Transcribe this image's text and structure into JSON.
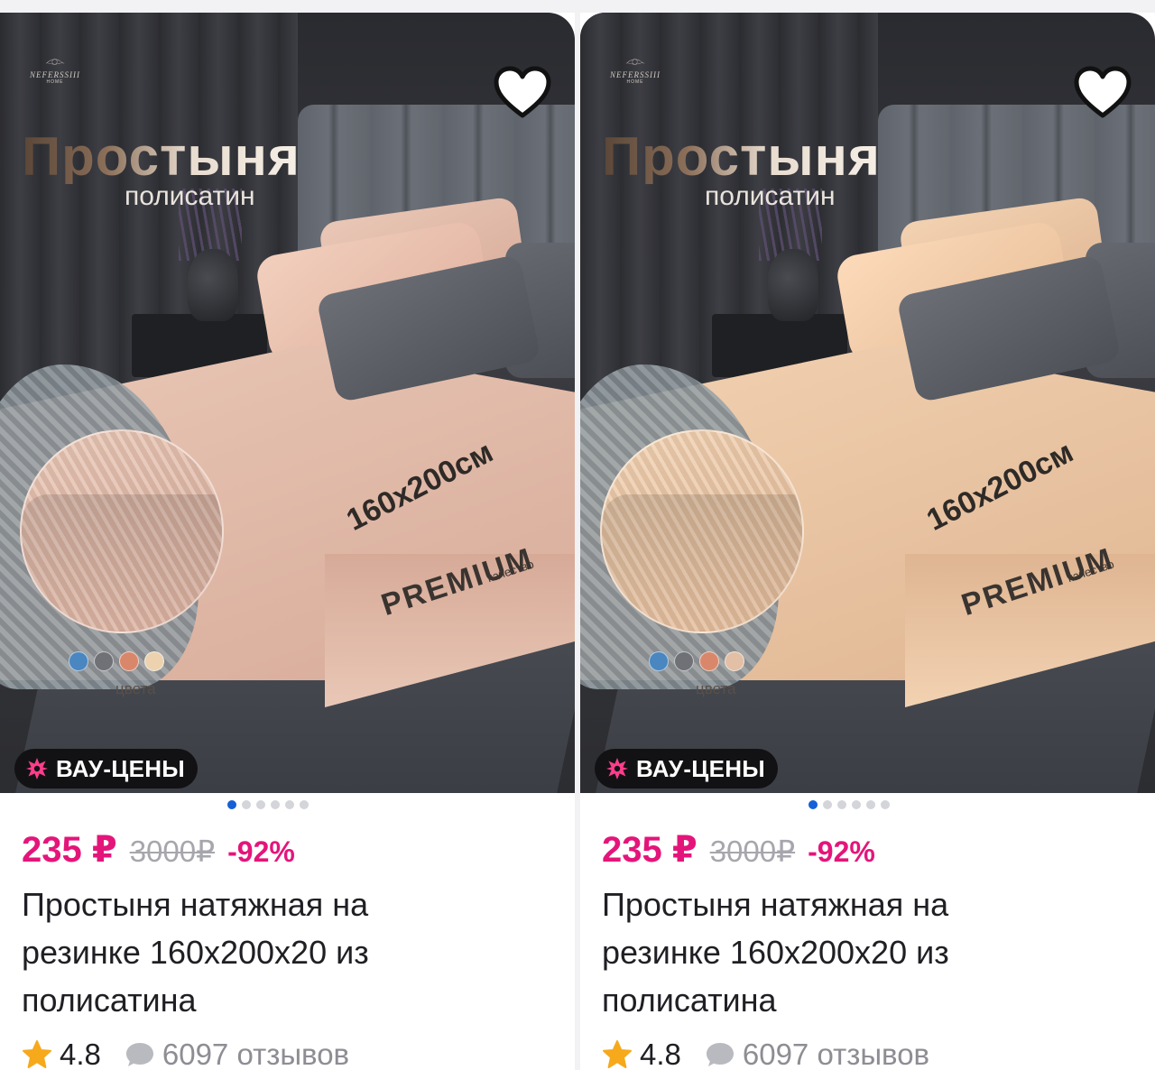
{
  "cards": [
    {
      "image": {
        "brand": "NEFERSSIII",
        "brand_sub": "HOME",
        "title": "Простыня",
        "subtitle": "полисатин",
        "size": "160x200см",
        "premium": "PREMIUM",
        "quality": "качество",
        "colors_label": "цвета",
        "swatch_colors": [
          "#4a86c0",
          "#6f7177",
          "#d9876b",
          "#ecd2ae"
        ],
        "sheet_color": "#e9c7b6",
        "sheet_color_dark": "#d7aa98"
      },
      "badge": {
        "label": "ВАУ-ЦЕНЫ",
        "icon": "burst-icon",
        "icon_color": "#ff3d8b"
      },
      "favorite_icon": "heart-icon",
      "carousel": {
        "count": 6,
        "active": 0
      },
      "price": "235 ₽",
      "old_price": "3000₽",
      "discount": "-92%",
      "name": "Простыня натяжная на резинке 160х200х20 из полисатина",
      "rating": "4.8",
      "reviews": "6097 отзывов"
    },
    {
      "image": {
        "brand": "NEFERSSIII",
        "brand_sub": "HOME",
        "title": "Простыня",
        "subtitle": "полисатин",
        "size": "160x200см",
        "premium": "PREMIUM",
        "quality": "качество",
        "colors_label": "цвета",
        "swatch_colors": [
          "#4a86c0",
          "#6f7177",
          "#d9876b",
          "#e2bfa5"
        ],
        "sheet_color": "#f2d2b2",
        "sheet_color_dark": "#dfb592"
      },
      "badge": {
        "label": "ВАУ-ЦЕНЫ",
        "icon": "burst-icon",
        "icon_color": "#ff3d8b"
      },
      "favorite_icon": "heart-icon",
      "carousel": {
        "count": 6,
        "active": 0
      },
      "price": "235 ₽",
      "old_price": "3000₽",
      "discount": "-92%",
      "name": "Простыня натяжная на резинке 160х200х20 из полисатина",
      "rating": "4.8",
      "reviews": "6097 отзывов"
    }
  ],
  "colors": {
    "price_accent": "#e4157a",
    "carousel_active": "#1560d6",
    "star": "#f6a91b",
    "review_bubble": "#b9bac0"
  }
}
